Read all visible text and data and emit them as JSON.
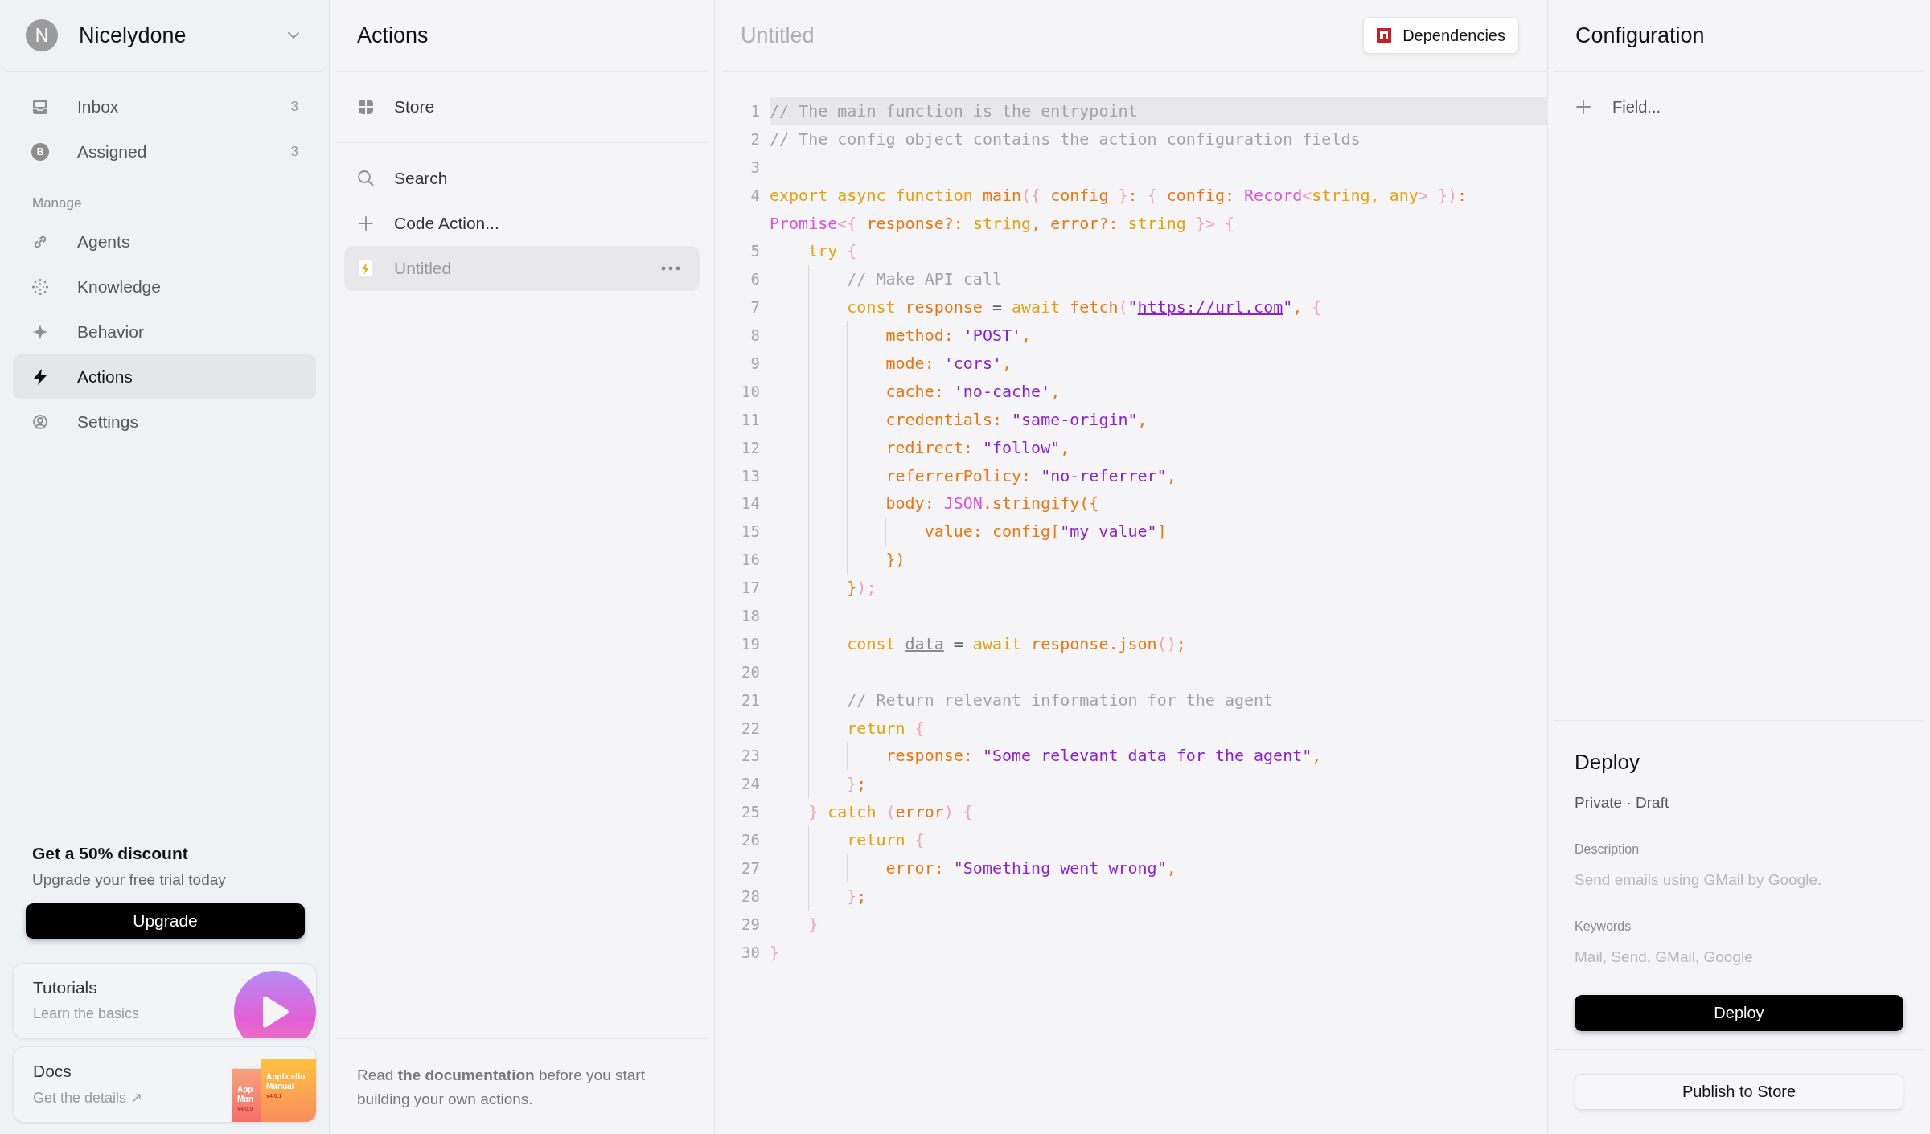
{
  "sidebar": {
    "workspace": {
      "initial": "N",
      "name": "Nicelydone"
    },
    "items": [
      {
        "label": "Inbox",
        "count": "3",
        "selected": false
      },
      {
        "label": "Assigned",
        "count": "3",
        "selected": false,
        "badge": "B"
      }
    ],
    "section_label": "Manage",
    "manage_items": [
      {
        "label": "Agents",
        "selected": false
      },
      {
        "label": "Knowledge",
        "selected": false
      },
      {
        "label": "Behavior",
        "selected": false
      },
      {
        "label": "Actions",
        "selected": true
      },
      {
        "label": "Settings",
        "selected": false
      }
    ],
    "promo": {
      "title": "Get a 50% discount",
      "subtitle": "Upgrade your free trial today",
      "button": "Upgrade"
    },
    "cards": [
      {
        "kind": "video",
        "title": "Tutorials",
        "subtitle": "Learn the basics"
      },
      {
        "kind": "manuals",
        "title": "Docs",
        "subtitle": "Get the details ↗",
        "covers": [
          {
            "lines": [
              "App",
              "Man"
            ],
            "version": "v4.0.0"
          },
          {
            "lines": [
              "Applicatio",
              "Manual"
            ],
            "version": "v4.0.1"
          }
        ]
      }
    ]
  },
  "actions_panel": {
    "title": "Actions",
    "store": "Store",
    "items": [
      {
        "kind": "search",
        "label": "Search",
        "selected": false
      },
      {
        "kind": "add",
        "label": "Code Action...",
        "selected": false
      },
      {
        "kind": "file",
        "label": "Untitled",
        "selected": true
      }
    ],
    "note": "Read **the documentation** before you start building your own actions."
  },
  "editor": {
    "title": "Untitled",
    "dependencies_button": "Dependencies",
    "lines": [
      {
        "number": "1",
        "current": true,
        "tokens": [
          {
            "kind": "comment",
            "text": "// The main function is the entrypoint"
          }
        ]
      },
      {
        "number": "2",
        "current": false,
        "tokens": [
          {
            "kind": "comment",
            "text": "// The config object contains the action configuration fields"
          }
        ]
      },
      {
        "number": "3",
        "current": false
      },
      {
        "number": "4",
        "current": false,
        "tokens": [
          {
            "kind": "keyword",
            "text": "export async function "
          },
          {
            "kind": "ident",
            "text": "main"
          },
          {
            "kind": "punct",
            "text": "({ "
          },
          {
            "kind": "ident",
            "text": "config"
          },
          {
            "kind": "punct",
            "text": " }"
          },
          {
            "kind": "ident",
            "text": ": "
          },
          {
            "kind": "punct",
            "text": "{ "
          },
          {
            "kind": "ident",
            "text": "config: "
          },
          {
            "kind": "type",
            "text": "Record"
          },
          {
            "kind": "punct",
            "text": "<"
          },
          {
            "kind": "keyword",
            "text": "string, any"
          },
          {
            "kind": "punct",
            "text": "> })"
          },
          {
            "kind": "ident",
            "text": ":"
          }
        ]
      },
      {
        "current": false,
        "tokens": [
          {
            "kind": "type",
            "text": "Promise"
          },
          {
            "kind": "punct",
            "text": "<{ "
          },
          {
            "kind": "ident",
            "text": "response?: "
          },
          {
            "kind": "keyword",
            "text": "string"
          },
          {
            "kind": "ident",
            "text": ", error?: "
          },
          {
            "kind": "keyword",
            "text": "string"
          },
          {
            "kind": "punct",
            "text": " }> {"
          }
        ]
      },
      {
        "number": "5",
        "current": false,
        "tokens": [
          {
            "kind": "keyword",
            "text": "    try "
          },
          {
            "kind": "punct",
            "text": "{"
          }
        ]
      },
      {
        "number": "6",
        "current": false,
        "tokens": [
          {
            "kind": "comment",
            "text": "        // Make API call"
          }
        ]
      },
      {
        "number": "7",
        "current": false,
        "tokens": [
          {
            "kind": "keyword",
            "text": "        const "
          },
          {
            "kind": "ident",
            "text": "response "
          },
          {
            "kind": "op",
            "text": "= "
          },
          {
            "kind": "keyword",
            "text": "await "
          },
          {
            "kind": "ident",
            "text": "fetch"
          },
          {
            "kind": "punct",
            "text": "("
          },
          {
            "kind": "string",
            "text": "\""
          },
          {
            "kind": "link",
            "text": "https://url.com"
          },
          {
            "kind": "string",
            "text": "\""
          },
          {
            "kind": "ident",
            "text": ", "
          },
          {
            "kind": "punct",
            "text": "{"
          }
        ]
      },
      {
        "number": "8",
        "current": false,
        "tokens": [
          {
            "kind": "ident",
            "text": "            method: "
          },
          {
            "kind": "string",
            "text": "'POST'"
          },
          {
            "kind": "ident",
            "text": ","
          }
        ]
      },
      {
        "number": "9",
        "current": false,
        "tokens": [
          {
            "kind": "ident",
            "text": "            mode: "
          },
          {
            "kind": "string",
            "text": "'cors'"
          },
          {
            "kind": "ident",
            "text": ","
          }
        ]
      },
      {
        "number": "10",
        "current": false,
        "tokens": [
          {
            "kind": "ident",
            "text": "            cache: "
          },
          {
            "kind": "string",
            "text": "'no-cache'"
          },
          {
            "kind": "ident",
            "text": ","
          }
        ]
      },
      {
        "number": "11",
        "current": false,
        "tokens": [
          {
            "kind": "ident",
            "text": "            credentials: "
          },
          {
            "kind": "string",
            "text": "\"same-origin\""
          },
          {
            "kind": "ident",
            "text": ","
          }
        ]
      },
      {
        "number": "12",
        "current": false,
        "tokens": [
          {
            "kind": "ident",
            "text": "            redirect: "
          },
          {
            "kind": "string",
            "text": "\"follow\""
          },
          {
            "kind": "ident",
            "text": ","
          }
        ]
      },
      {
        "number": "13",
        "current": false,
        "tokens": [
          {
            "kind": "ident",
            "text": "            referrerPolicy: "
          },
          {
            "kind": "string",
            "text": "\"no-referrer\""
          },
          {
            "kind": "ident",
            "text": ","
          }
        ]
      },
      {
        "number": "14",
        "current": false,
        "tokens": [
          {
            "kind": "ident",
            "text": "            body: "
          },
          {
            "kind": "type",
            "text": "JSON"
          },
          {
            "kind": "ident",
            "text": ".stringify({"
          }
        ]
      },
      {
        "number": "15",
        "current": false,
        "tokens": [
          {
            "kind": "ident",
            "text": "                value: config["
          },
          {
            "kind": "string",
            "text": "\"my value\""
          },
          {
            "kind": "ident",
            "text": "]"
          }
        ]
      },
      {
        "number": "16",
        "current": false,
        "tokens": [
          {
            "kind": "ident",
            "text": "            })"
          }
        ]
      },
      {
        "number": "17",
        "current": false,
        "tokens": [
          {
            "kind": "ident",
            "text": "        }"
          },
          {
            "kind": "punct",
            "text": ");"
          }
        ]
      },
      {
        "number": "18",
        "current": false
      },
      {
        "number": "19",
        "current": false,
        "tokens": [
          {
            "kind": "keyword",
            "text": "        const "
          },
          {
            "kind": "var",
            "text": "data"
          },
          {
            "kind": "op",
            "text": " = "
          },
          {
            "kind": "keyword",
            "text": "await "
          },
          {
            "kind": "ident",
            "text": "response.json"
          },
          {
            "kind": "punct",
            "text": "()"
          },
          {
            "kind": "ident",
            "text": ";"
          }
        ]
      },
      {
        "number": "20",
        "current": false
      },
      {
        "number": "21",
        "current": false,
        "tokens": [
          {
            "kind": "comment",
            "text": "        // Return relevant information for the agent"
          }
        ]
      },
      {
        "number": "22",
        "current": false,
        "tokens": [
          {
            "kind": "keyword",
            "text": "        return "
          },
          {
            "kind": "punct",
            "text": "{"
          }
        ]
      },
      {
        "number": "23",
        "current": false,
        "tokens": [
          {
            "kind": "ident",
            "text": "            response: "
          },
          {
            "kind": "string",
            "text": "\"Some relevant data for the agent\""
          },
          {
            "kind": "ident",
            "text": ","
          }
        ]
      },
      {
        "number": "24",
        "current": false,
        "tokens": [
          {
            "kind": "punct",
            "text": "        }"
          },
          {
            "kind": "ident",
            "text": ";"
          }
        ]
      },
      {
        "number": "25",
        "current": false,
        "tokens": [
          {
            "kind": "punct",
            "text": "    } "
          },
          {
            "kind": "keyword",
            "text": "catch "
          },
          {
            "kind": "punct",
            "text": "("
          },
          {
            "kind": "ident",
            "text": "error"
          },
          {
            "kind": "punct",
            "text": ") {"
          }
        ]
      },
      {
        "number": "26",
        "current": false,
        "tokens": [
          {
            "kind": "keyword",
            "text": "        return "
          },
          {
            "kind": "punct",
            "text": "{"
          }
        ]
      },
      {
        "number": "27",
        "current": false,
        "tokens": [
          {
            "kind": "ident",
            "text": "            error: "
          },
          {
            "kind": "string",
            "text": "\"Something went wrong\""
          },
          {
            "kind": "ident",
            "text": ","
          }
        ]
      },
      {
        "number": "28",
        "current": false,
        "tokens": [
          {
            "kind": "punct",
            "text": "        }"
          },
          {
            "kind": "ident",
            "text": ";"
          }
        ]
      },
      {
        "number": "29",
        "current": false,
        "tokens": [
          {
            "kind": "punct",
            "text": "    }"
          }
        ]
      },
      {
        "number": "30",
        "current": false,
        "tokens": [
          {
            "kind": "punct",
            "text": "}"
          }
        ]
      }
    ]
  },
  "configuration": {
    "title": "Configuration",
    "add_field": "Field...",
    "deploy": {
      "title": "Deploy",
      "status": "Private · Draft",
      "fields": [
        {
          "label": "Description",
          "placeholder": "Send emails using GMail by Google."
        },
        {
          "label": "Keywords",
          "placeholder": "Mail, Send, GMail, Google"
        }
      ],
      "deploy_button": "Deploy",
      "publish_button": "Publish to Store"
    }
  }
}
